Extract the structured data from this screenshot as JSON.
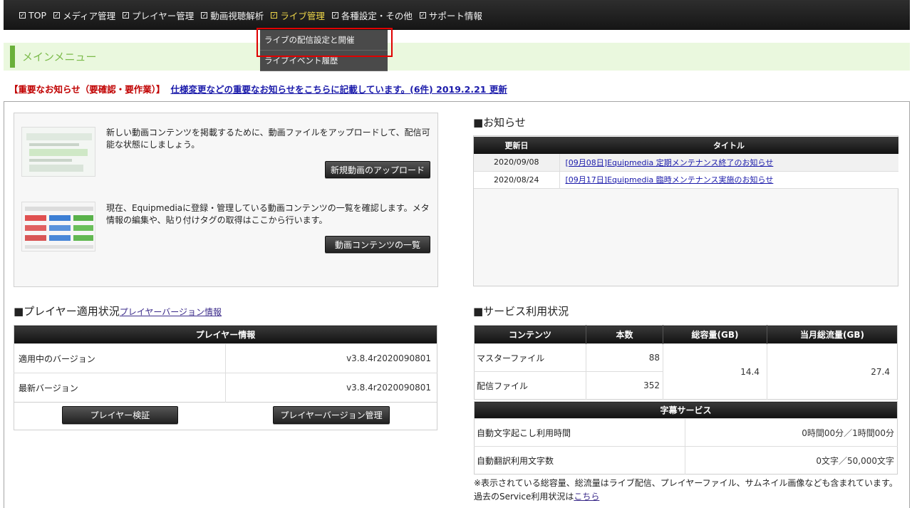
{
  "nav": {
    "items": [
      {
        "label": "TOP"
      },
      {
        "label": "メディア管理"
      },
      {
        "label": "プレイヤー管理"
      },
      {
        "label": "動画視聴解析"
      },
      {
        "label": "ライブ管理"
      },
      {
        "label": "各種設定・その他"
      },
      {
        "label": "サポート情報"
      }
    ],
    "active_index": 4,
    "active_color": "#f0d84a"
  },
  "dropdown": {
    "items": [
      {
        "label": "ライブの配信設定と開催"
      },
      {
        "label": "ライブイベント履歴"
      }
    ],
    "highlight_color": "#e00000"
  },
  "menubar": {
    "title": "メインメニュー",
    "accent": "#6ab03a"
  },
  "notice": {
    "label": "【重要なお知らせ（要確認・要作業）】",
    "link": "仕様変更などの重要なお知らせをこちらに記載しています。(6件) 2019.2.21 更新"
  },
  "intro": {
    "upload_text": "新しい動画コンテンツを掲載するために、動画ファイルをアップロードして、配信可能な状態にしましょう。",
    "upload_button": "新規動画のアップロード",
    "list_text": "現在、Equipmediaに登録・管理している動画コンテンツの一覧を確認します。メタ情報の編集や、貼り付けタグの取得はここから行います。",
    "list_button": "動画コンテンツの一覧"
  },
  "news": {
    "title": "■お知らせ",
    "headers": {
      "date": "更新日",
      "title": "タイトル"
    },
    "rows": [
      {
        "date": "2020/09/08",
        "title": "[09月08日]Equipmedia 定期メンテナンス終了のお知らせ"
      },
      {
        "date": "2020/08/24",
        "title": "[09月17日]Equipmedia 臨時メンテナンス実施のお知らせ"
      }
    ]
  },
  "player": {
    "title": "■プレイヤー適用状況",
    "title_link": "プレイヤーバージョン情報",
    "header": "プレイヤー情報",
    "rows": [
      {
        "label": "適用中のバージョン",
        "value": "v3.8.4r2020090801"
      },
      {
        "label": "最新バージョン",
        "value": "v3.8.4r2020090801"
      }
    ],
    "verify_button": "プレイヤー検証",
    "manage_button": "プレイヤーバージョン管理"
  },
  "service": {
    "title": "■サービス利用状況",
    "headers": {
      "content": "コンテンツ",
      "count": "本数",
      "capacity": "総容量(GB)",
      "traffic": "当月総流量(GB)"
    },
    "rows": [
      {
        "name": "マスターファイル",
        "count": "88"
      },
      {
        "name": "配信ファイル",
        "count": "352"
      }
    ],
    "capacity": "14.4",
    "traffic": "27.4",
    "subtitle_header": "字幕サービス",
    "subtitle_rows": [
      {
        "label": "自動文字起こし利用時間",
        "value": "0時間00分／1時間00分"
      },
      {
        "label": "自動翻訳利用文字数",
        "value": "0文字／50,000文字"
      }
    ],
    "footnote": "※表示されている総容量、総流量はライブ配信、プレイヤーファイル、サムネイル画像なども含まれています。",
    "past_prefix": "過去のService利用状況は",
    "past_link": "こちら"
  }
}
